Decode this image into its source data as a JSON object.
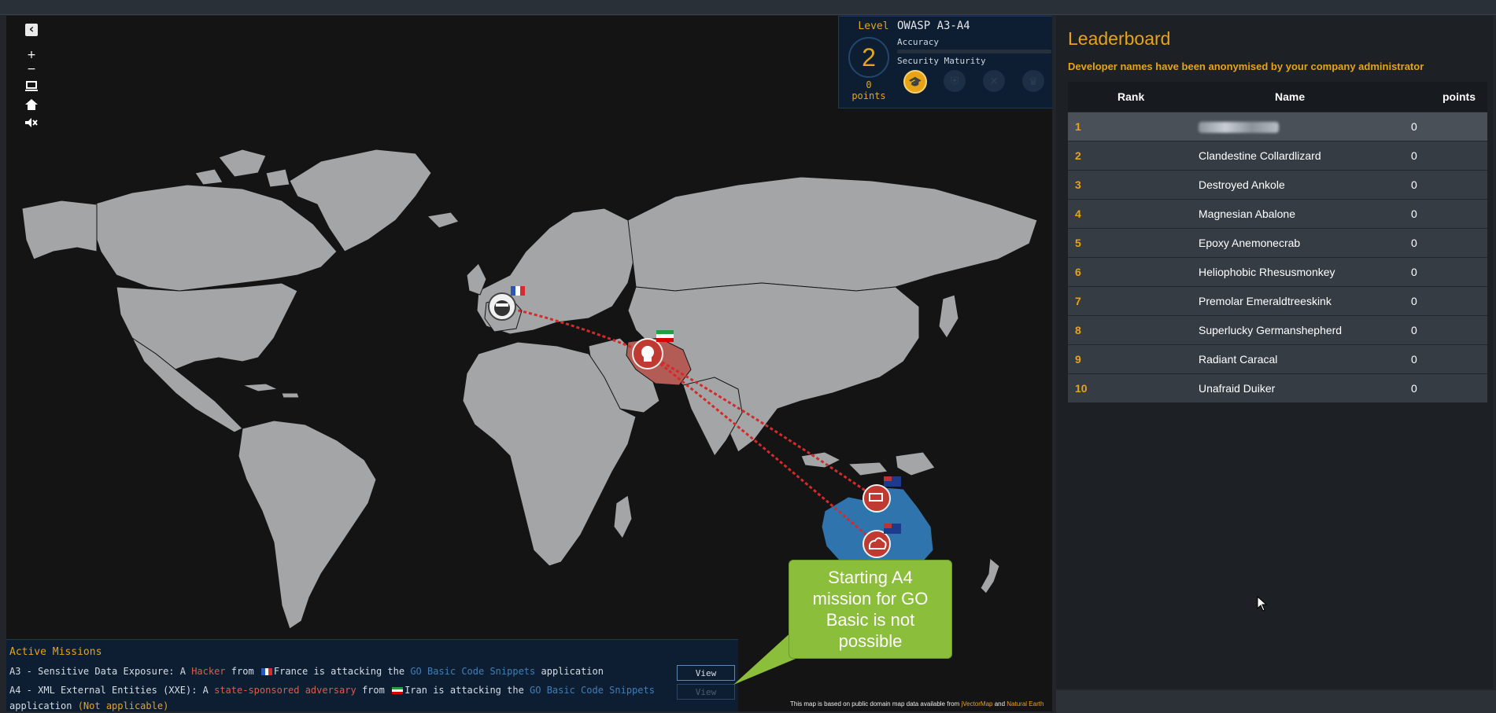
{
  "map_controls": {
    "collapse": "‹",
    "zoom_in": "+",
    "zoom_out": "−"
  },
  "level_box": {
    "level_label": "Level",
    "level_value": "2",
    "points_value": "0",
    "points_label": "points",
    "mission_title": "OWASP A3-A4",
    "accuracy_label": "Accuracy",
    "security_maturity_label": "Security Maturity"
  },
  "active_missions": {
    "title": "Active Missions",
    "missions": [
      {
        "prefix": "A3 - Sensitive Data Exposure: A ",
        "attacker": "Hacker",
        "from": " from ",
        "country": "France",
        "middle": " is attacking the ",
        "app": "GO Basic Code Snippets",
        "suffix": " application",
        "button": "View"
      },
      {
        "prefix": "A4 - XML External Entities (XXE): A ",
        "attacker": "state-sponsored adversary",
        "from": " from ",
        "country": "Iran",
        "middle": " is attacking the ",
        "app": "GO Basic Code Snippets",
        "suffix_line2": "application ",
        "status": "(Not applicable)",
        "button": "View"
      }
    ]
  },
  "attribution": {
    "text": "This map is based on public domain map data available from ",
    "link1": "jVectorMap",
    "and": " and ",
    "link2": "Natural Earth"
  },
  "callout": {
    "text": "Starting A4 mission for GO Basic is not possible"
  },
  "leaderboard": {
    "title": "Leaderboard",
    "subtitle": "Developer names have been anonymised by your company administrator",
    "columns": [
      "Rank",
      "Name",
      "points"
    ],
    "rows": [
      {
        "rank": "1",
        "name": "",
        "points": "0"
      },
      {
        "rank": "2",
        "name": "Clandestine Collardlizard",
        "points": "0"
      },
      {
        "rank": "3",
        "name": "Destroyed Ankole",
        "points": "0"
      },
      {
        "rank": "4",
        "name": "Magnesian Abalone",
        "points": "0"
      },
      {
        "rank": "5",
        "name": "Epoxy Anemonecrab",
        "points": "0"
      },
      {
        "rank": "6",
        "name": "Heliophobic Rhesusmonkey",
        "points": "0"
      },
      {
        "rank": "7",
        "name": "Premolar Emeraldtreeskink",
        "points": "0"
      },
      {
        "rank": "8",
        "name": "Superlucky Germanshepherd",
        "points": "0"
      },
      {
        "rank": "9",
        "name": "Radiant Caracal",
        "points": "0"
      },
      {
        "rank": "10",
        "name": "Unafraid Duiker",
        "points": "0"
      }
    ]
  },
  "colors": {
    "accent": "#e8a317",
    "map_land": "#a4a5a7",
    "map_ocean": "#141414",
    "highlight_country": "#2f74ad",
    "attacker_country": "#b35b55",
    "attack_line": "#d42a2a",
    "callout_bg": "#8bbe3a"
  }
}
